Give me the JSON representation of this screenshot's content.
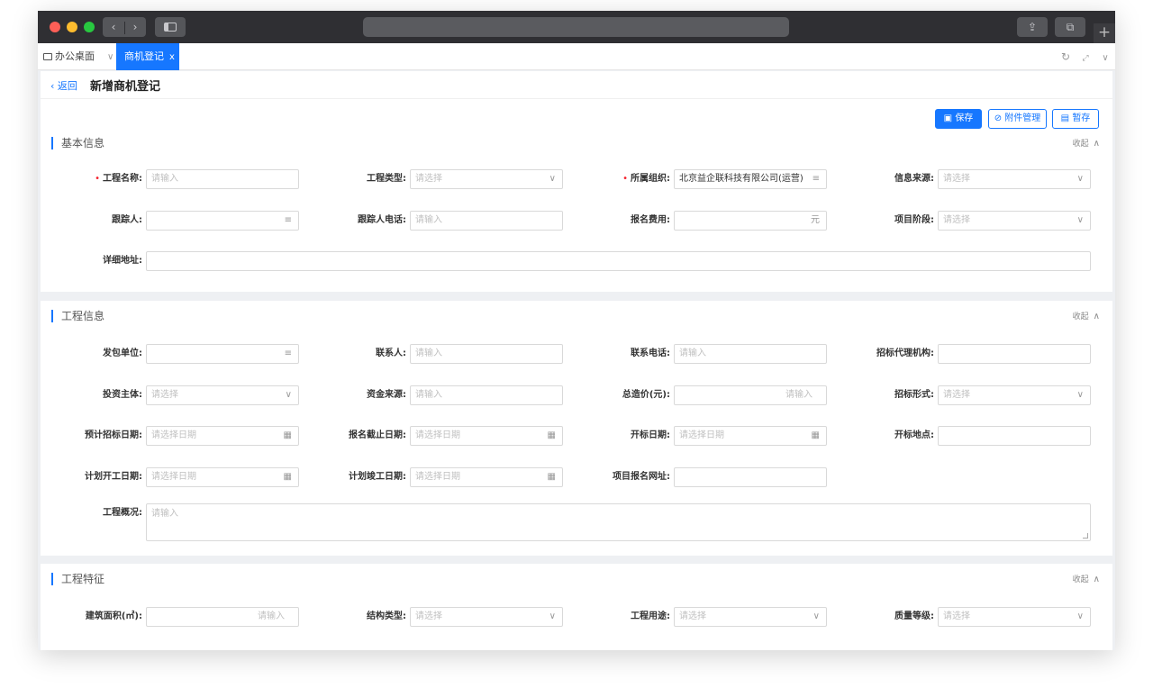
{
  "tabs": {
    "home_label": "办公桌面",
    "active_label": "商机登记",
    "active_close": "x"
  },
  "header": {
    "back_label": "返回",
    "title": "新增商机登记",
    "save_label": "保存",
    "attach_label": "附件管理",
    "draft_label": "暂存"
  },
  "collapse_label": "收起",
  "basic": {
    "title": "基本信息",
    "project_name": {
      "label": "工程名称:",
      "placeholder": "请输入"
    },
    "project_type": {
      "label": "工程类型:",
      "placeholder": "请选择"
    },
    "org": {
      "label": "所属组织:",
      "value": "北京益企联科技有限公司(运营)"
    },
    "info_source": {
      "label": "信息来源:",
      "placeholder": "请选择"
    },
    "tracker": {
      "label": "跟踪人:"
    },
    "tracker_phone": {
      "label": "跟踪人电话:",
      "placeholder": "请输入"
    },
    "fee": {
      "label": "报名费用:",
      "unit": "元"
    },
    "stage": {
      "label": "项目阶段:",
      "placeholder": "请选择"
    },
    "address": {
      "label": "详细地址:"
    }
  },
  "project": {
    "title": "工程信息",
    "contractor": {
      "label": "发包单位:"
    },
    "contact": {
      "label": "联系人:",
      "placeholder": "请输入"
    },
    "contact_phone": {
      "label": "联系电话:",
      "placeholder": "请输入"
    },
    "agency": {
      "label": "招标代理机构:"
    },
    "investor": {
      "label": "投资主体:",
      "placeholder": "请选择"
    },
    "fund_source": {
      "label": "资金来源:",
      "placeholder": "请输入"
    },
    "total_cost": {
      "label": "总造价(元):",
      "placeholder": "请输入"
    },
    "bid_form": {
      "label": "招标形式:",
      "placeholder": "请选择"
    },
    "bid_date": {
      "label": "预计招标日期:",
      "placeholder": "请选择日期"
    },
    "reg_deadline": {
      "label": "报名截止日期:",
      "placeholder": "请选择日期"
    },
    "open_date": {
      "label": "开标日期:",
      "placeholder": "请选择日期"
    },
    "open_place": {
      "label": "开标地点:"
    },
    "start_date": {
      "label": "计划开工日期:",
      "placeholder": "请选择日期"
    },
    "finish_date": {
      "label": "计划竣工日期:",
      "placeholder": "请选择日期"
    },
    "reg_url": {
      "label": "项目报名网址:"
    },
    "overview": {
      "label": "工程概况:",
      "placeholder": "请输入"
    }
  },
  "features": {
    "title": "工程特征",
    "area": {
      "label": "建筑面积(㎡):",
      "placeholder": "请输入"
    },
    "structure": {
      "label": "结构类型:",
      "placeholder": "请选择"
    },
    "usage": {
      "label": "工程用途:",
      "placeholder": "请选择"
    },
    "quality": {
      "label": "质量等级:",
      "placeholder": "请选择"
    }
  },
  "colors": {
    "primary": "#1677ff",
    "required": "#f5222d"
  }
}
